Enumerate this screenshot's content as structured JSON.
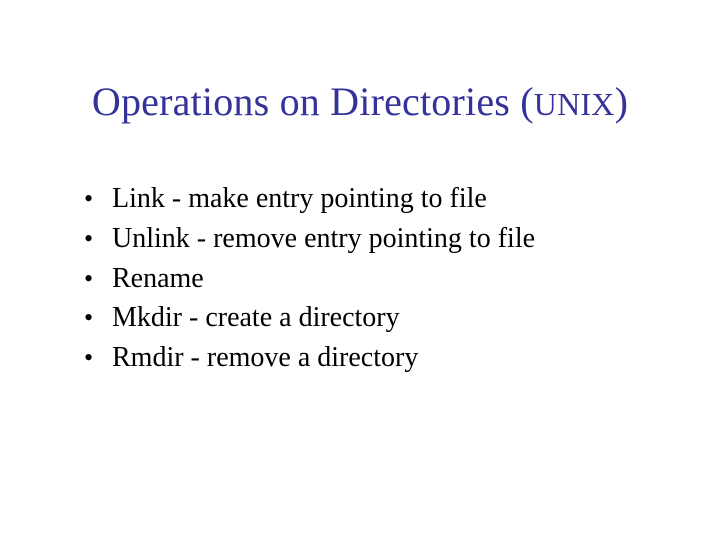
{
  "title": {
    "main": "Operations on Directories ",
    "lparen": "(",
    "unix": "UNIX",
    "rparen": ")"
  },
  "bullets": [
    "Link - make entry pointing to file",
    "Unlink - remove entry pointing to file",
    "Rename",
    "Mkdir - create a directory",
    "Rmdir - remove a directory"
  ]
}
